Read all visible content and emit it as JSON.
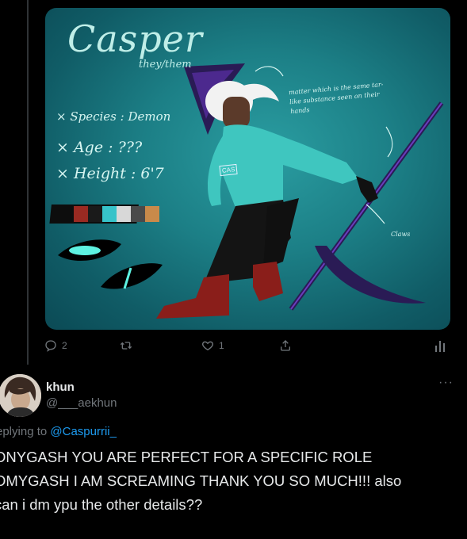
{
  "media": {
    "title": "Casper",
    "pronouns": "they/them",
    "stats": [
      "× Species : Demon",
      "× Age : ???",
      "× Height : 6'7"
    ],
    "note": "matter which is the same tar-like substance seen on their hands",
    "claws_label": "Claws",
    "signature": "CAS",
    "palette": [
      "#9a2a22",
      "#1a1a1a",
      "#37c3c9",
      "#d8d8d8",
      "#4a4a4a",
      "#c98a4a"
    ],
    "colors": {
      "hoodie": "#3fc6bf",
      "scythe": "#2a1b55",
      "boots": "#8a1e1a"
    }
  },
  "actions": {
    "reply_count": "2",
    "like_count": "1"
  },
  "reply": {
    "name": "khun",
    "handle": "@___aekhun",
    "replying_prefix": "eplying to ",
    "replying_to": "@Caspurrii_",
    "lines": [
      "ONYGASH YOU ARE PERFECT FOR A SPECIFIC ROLE",
      "OMYGASH I AM SCREAMING THANK YOU SO MUCH!!! also",
      "can i dm ypu the other details??"
    ],
    "more_label": "···"
  }
}
